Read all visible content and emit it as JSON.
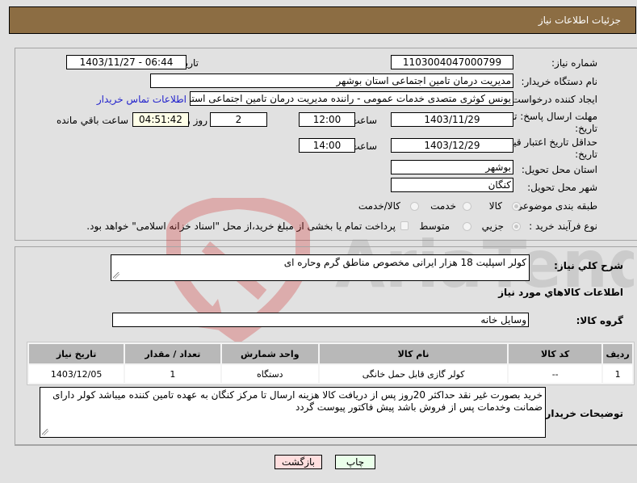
{
  "header": {
    "title": "جزئیات اطلاعات نیاز"
  },
  "form": {
    "need_number": {
      "label": "شماره نیاز:",
      "value": "1103004047000799"
    },
    "announce_datetime": {
      "label": "تاریخ و ساعت اعلان عمومي:",
      "value": "1403/11/27 - 06:44"
    },
    "buyer_org": {
      "label": "نام دستگاه خریدار:",
      "value": "مدیریت درمان تامین اجتماعی استان بوشهر"
    },
    "requester": {
      "label": "ایجاد کننده درخواست:",
      "value": "یونس کوثری متصدی خدمات عمومی - راننده مدیریت درمان تامین اجتماعی استا",
      "contact_link": "اطلاعات تماس خریدار"
    },
    "response_deadline": {
      "label_line1": "مهلت ارسال پاسخ: تا",
      "label_line2": "تاریخ:",
      "date": "1403/11/29",
      "time_label": "ساعت",
      "time": "12:00",
      "days": "2",
      "days_label": "روز و",
      "remaining": "04:51:42",
      "remaining_label": "ساعت باقي مانده"
    },
    "price_validity": {
      "label_line1": "حداقل تاریخ اعتبار قیمت: تا",
      "label_line2": "تاریخ:",
      "date": "1403/12/29",
      "time_label": "ساعت",
      "time": "14:00"
    },
    "delivery_province": {
      "label": "استان محل تحویل:",
      "value": "بوشهر"
    },
    "delivery_city": {
      "label": "شهر محل تحویل:",
      "value": "کنگان"
    },
    "category": {
      "label": "طبقه بندی موضوعی:",
      "options": [
        "کالا",
        "خدمت",
        "کالا/خدمت"
      ],
      "selected": "کالا"
    },
    "purchase_type": {
      "label": "نوع فرآیند خرید :",
      "options": [
        "جزیي",
        "متوسط"
      ],
      "selected": "جزیي",
      "treasury_checkbox_label": "پرداخت تمام یا بخشی از مبلغ خرید،از محل \"اسناد خزانه اسلامی\" خواهد بود.",
      "treasury_checked": false
    }
  },
  "details": {
    "general_desc": {
      "label": "شرح کلي نیاز:",
      "value": "کولر اسپلیت 18 هزار ایرانی مخصوص مناطق گرم وحاره ای"
    },
    "goods_info_title": "اطلاعات کالاهاي مورد نیاز",
    "goods_group": {
      "label": "گروه کالا:",
      "value": "وسایل خانه"
    },
    "table": {
      "columns": [
        "ردیف",
        "کد کالا",
        "نام کالا",
        "واحد شمارش",
        "تعداد / مقدار",
        "تاریخ نیاز"
      ],
      "rows": [
        [
          "1",
          "--",
          "کولر گازی قابل حمل خانگی",
          "دستگاه",
          "1",
          "1403/12/05"
        ]
      ]
    },
    "buyer_notes": {
      "label": "توضیحات خریدار:",
      "value": "خرید بصورت غیر نقد حداکثر 20روز پس از دریافت کالا هزینه ارسال تا مرکز کنگان به عهده تامین کننده میباشد کولر دارای ضمانت وخدمات پس از فروش باشد پیش فاکتور پیوست گردد"
    }
  },
  "buttons": {
    "print": "چاپ",
    "back": "بازگشت"
  },
  "watermark": {
    "text": "AriaTender.neT"
  },
  "colors": {
    "header_bg": "#8c6d43",
    "link": "#2222cc",
    "back_btn": "#ffdede",
    "print_btn": "#eaffea"
  }
}
